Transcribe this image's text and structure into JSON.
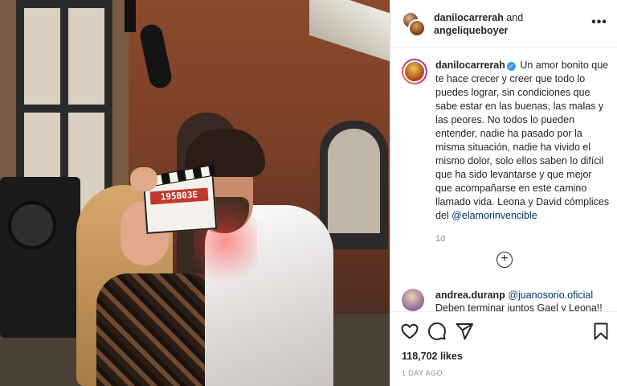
{
  "header": {
    "user1": "danilocarrerah",
    "joiner": "and",
    "user2": "angeliqueboyer",
    "more_icon": "more-horizontal-icon"
  },
  "photo": {
    "clapper_code": "195B03E"
  },
  "caption": {
    "username": "danilocarrerah",
    "verified_icon": "verified-badge-icon",
    "text": "Un amor bonito que te hace crecer y creer que todo lo puedes lograr, sin condiciones que sabe estar en las buenas, las malas y las peores. No todos lo pueden entender, nadie ha pasado por la misma situación, nadie ha vivido el mismo dolor, solo ellos saben lo difícil que ha sido levantarse y que mejor que acompañarse en este camino llamado vida. Leona y David cómplices del",
    "mention": "@elamorinvencible",
    "time": "1d",
    "load_more_icon": "plus-circle-icon"
  },
  "comment": {
    "username": "andrea.duranp",
    "mention": "@juanosorio.oficial",
    "text": "Deben terminar juntos Gael y Leona!!"
  },
  "actions": {
    "like_icon": "heart-icon",
    "comment_icon": "comment-icon",
    "share_icon": "send-icon",
    "save_icon": "bookmark-icon",
    "likes": "118,702 likes",
    "date": "1 DAY AGO"
  },
  "colors": {
    "link": "#00376b",
    "verified": "#3897f0",
    "muted": "#8e8e8e",
    "text": "#262626"
  }
}
